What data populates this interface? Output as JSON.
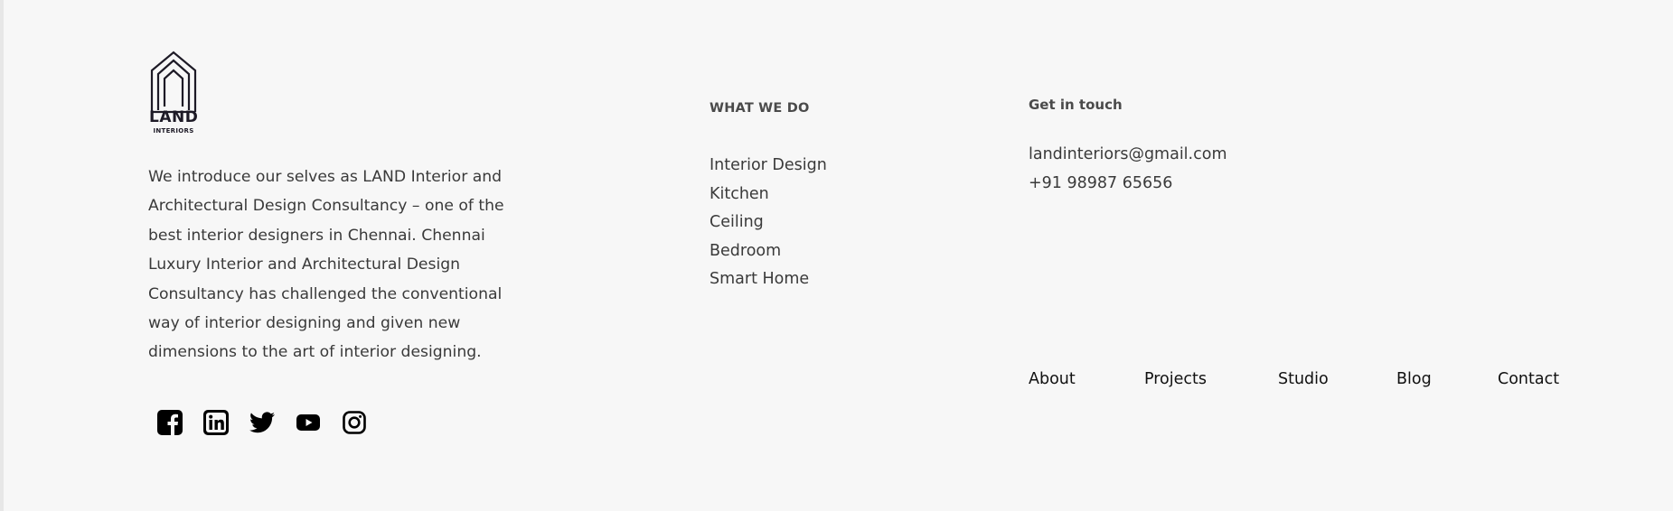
{
  "brand": {
    "logo_main": "LAND",
    "logo_sub": "INTERIORS",
    "color": "#1d1a26"
  },
  "intro": {
    "text": "We introduce our selves as  LAND Interior and Architectural Design Consultancy – one of the best interior designers in Chennai. Chennai Luxury Interior and Architectural Design Consultancy has challenged the conventional way of interior designing and given new dimensions to the art of interior designing."
  },
  "social": {
    "icons": [
      "facebook-icon",
      "linkedin-icon",
      "twitter-icon",
      "youtube-icon",
      "instagram-icon"
    ]
  },
  "services": {
    "heading": "WHAT WE DO",
    "items": [
      "Interior Design",
      "Kitchen",
      "Ceiling",
      "Bedroom",
      "Smart Home"
    ]
  },
  "contact": {
    "heading": "Get in touch",
    "email": "landinteriors@gmail.com",
    "phone": "+91 98987 65656"
  },
  "footer_nav": {
    "items": [
      "About",
      "Projects",
      "Studio",
      "Blog",
      "Contact"
    ]
  }
}
